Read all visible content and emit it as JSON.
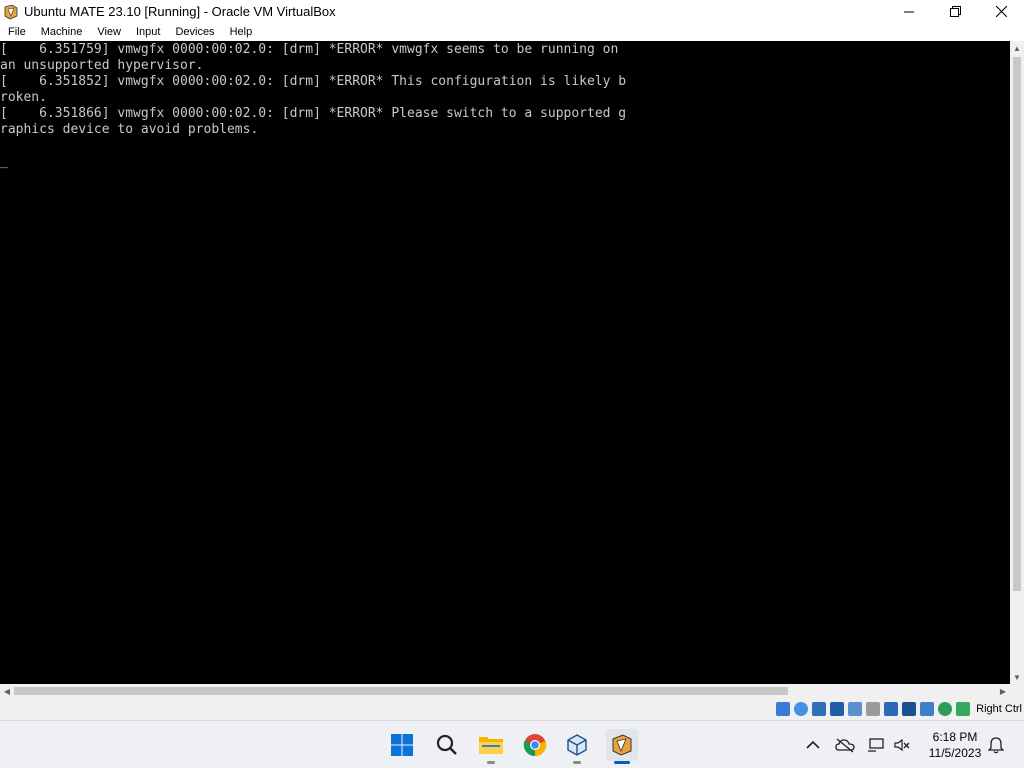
{
  "window": {
    "title": "Ubuntu MATE 23.10 [Running] - Oracle VM VirtualBox",
    "controls": {
      "minimize": "—",
      "maximize": "☐",
      "close": "✕"
    }
  },
  "menubar": {
    "items": [
      "File",
      "Machine",
      "View",
      "Input",
      "Devices",
      "Help"
    ]
  },
  "console": {
    "lines": [
      "[    6.351759] vmwgfx 0000:00:02.0: [drm] *ERROR* vmwgfx seems to be running on",
      "an unsupported hypervisor.",
      "[    6.351852] vmwgfx 0000:00:02.0: [drm] *ERROR* This configuration is likely b",
      "roken.",
      "[    6.351866] vmwgfx 0000:00:02.0: [drm] *ERROR* Please switch to a supported g",
      "raphics device to avoid problems.",
      "",
      "_"
    ]
  },
  "statusbar": {
    "host_key": "Right Ctrl",
    "icons": [
      "hard-disk-icon",
      "optical-drive-icon",
      "audio-icon",
      "network-icon",
      "usb-icon",
      "shared-folders-icon",
      "display-icon",
      "recording-icon",
      "cpu-icon",
      "virtualization-icon",
      "mouse-integration-icon",
      "keyboard-icon"
    ]
  },
  "taskbar": {
    "apps": [
      "start-icon",
      "search-icon",
      "file-explorer-icon",
      "chrome-icon",
      "virtualbox-manager-icon",
      "virtualbox-vm-icon"
    ],
    "clock": {
      "time": "6:18 PM",
      "date": "11/5/2023"
    }
  },
  "colors": {
    "console_bg": "#000000",
    "console_text": "#c8c8c8",
    "windows_accent": "#005fb8"
  }
}
